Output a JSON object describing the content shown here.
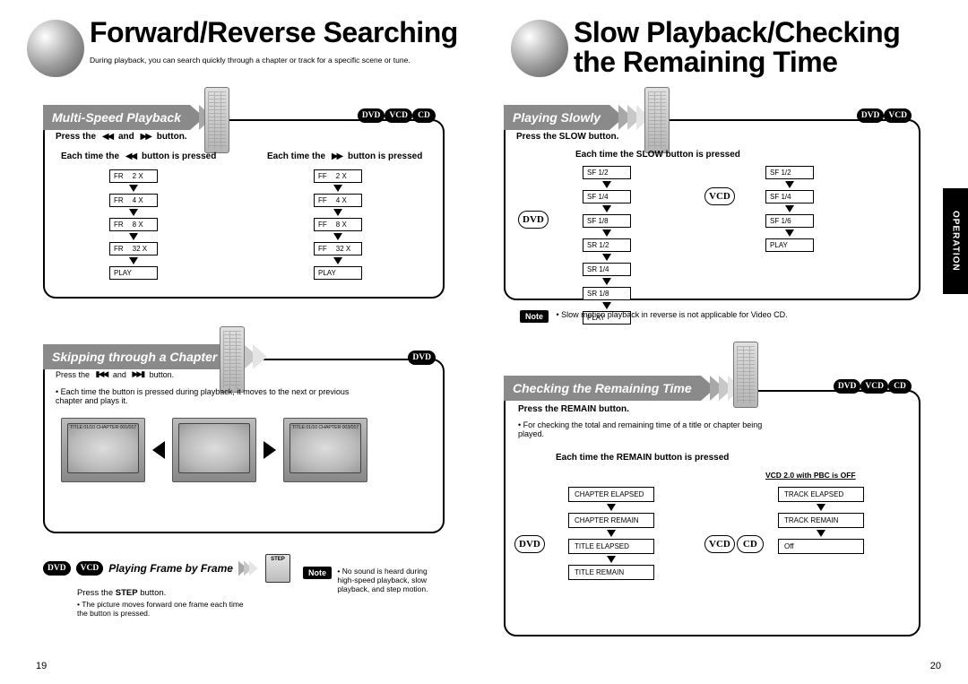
{
  "left": {
    "pagenum": "19",
    "title": "Forward/Reverse Searching",
    "intro": "During playback, you can search quickly through a chapter or track for a specific scene or tune.",
    "sec1": {
      "heading": "Multi-Speed Playback",
      "discs": [
        "DVD",
        "VCD",
        "CD"
      ],
      "press_line": "Press the    and    button.",
      "col_rr_title": "Each time the    button is pressed",
      "col_ff_title": "Each time the    button is pressed",
      "rr": [
        [
          "FR",
          "2 X"
        ],
        [
          "FR",
          "4 X"
        ],
        [
          "FR",
          "8 X"
        ],
        [
          "FR",
          "32 X"
        ],
        [
          "PLAY",
          ""
        ]
      ],
      "ff": [
        [
          "FF",
          "2 X"
        ],
        [
          "FF",
          "4 X"
        ],
        [
          "FF",
          "8 X"
        ],
        [
          "FF",
          "32 X"
        ],
        [
          "PLAY",
          ""
        ]
      ]
    },
    "sec2": {
      "heading": "Skipping through a Chapter",
      "discs": [
        "DVD"
      ],
      "press_line": "Press the    and    button.",
      "bullet": "Each time the button is pressed during playback, it moves to the next or previous chapter and plays it.",
      "osd_left": "TITLE 01/10  CHAPTER  001/017",
      "osd_right": "TITLE 01/10  CHAPTER  003/017"
    },
    "frame": {
      "discs": [
        "DVD",
        "VCD"
      ],
      "heading": "Playing Frame by Frame",
      "step_label": "STEP",
      "press": "Press the STEP button.",
      "bullet": "The picture moves forward one frame each time the button is pressed.",
      "note_label": "Note",
      "note_text": "No sound is heard during high-speed playback, slow playback, and step motion."
    }
  },
  "right": {
    "pagenum": "20",
    "title_l1": "Slow Playback/Checking",
    "title_l2": "the Remaining Time",
    "side_tab": "OPERATION",
    "sec1": {
      "heading": "Playing Slowly",
      "discs": [
        "DVD",
        "VCD"
      ],
      "press": "Press the SLOW button.",
      "each": "Each time the SLOW button is pressed",
      "dvd_seq": [
        "SF  1/2",
        "SF  1/4",
        "SF  1/8",
        "SR  1/2",
        "SR  1/4",
        "SR  1/8",
        "PLAY"
      ],
      "vcd_seq": [
        "SF  1/2",
        "SF  1/4",
        "SF  1/6",
        "PLAY"
      ],
      "note_label": "Note",
      "note_text": "Slow motion playback in reverse is not applicable for Video CD."
    },
    "sec2": {
      "heading": "Checking the Remaining Time",
      "discs": [
        "DVD",
        "VCD",
        "CD"
      ],
      "press": "Press the REMAIN button.",
      "bullet": "For checking the total and remaining time of a title or chapter being played.",
      "each": "Each time the REMAIN button is pressed",
      "vcd_header": "VCD 2.0 with PBC is OFF",
      "dvd_seq": [
        "CHAPTER ELAPSED",
        "CHAPTER REMAIN",
        "TITLE ELAPSED",
        "TITLE REMAIN"
      ],
      "vcd_seq": [
        "TRACK ELAPSED",
        "TRACK REMAIN",
        "Off"
      ]
    }
  }
}
